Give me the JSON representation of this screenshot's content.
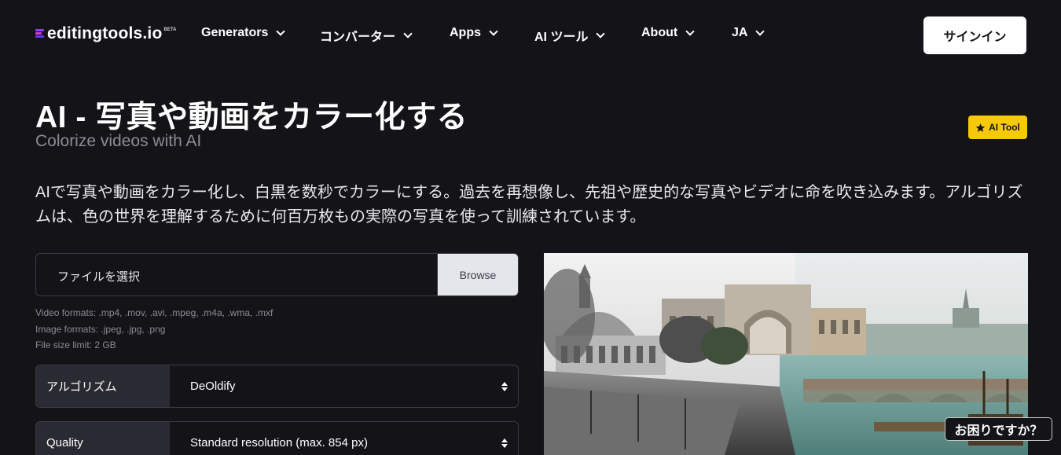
{
  "nav": {
    "logo_text": "editingtools.io",
    "logo_beta": "BETA",
    "items": [
      {
        "label": "Generators"
      },
      {
        "label": "コンバーター"
      },
      {
        "label": "Apps"
      },
      {
        "label": "AI ツール"
      },
      {
        "label": "About"
      },
      {
        "label": "JA"
      }
    ],
    "signin_label": "サインイン"
  },
  "header": {
    "title": "AI - 写真や動画をカラー化する",
    "subtitle": "Colorize videos with AI",
    "badge_label": "AI Tool",
    "description": "AIで写真や動画をカラー化し、白黒を数秒でカラーにする。過去を再想像し、先祖や歴史的な写真やビデオに命を吹き込みます。アルゴリズムは、色の世界を理解するために何百万枚もの実際の写真を使って訓練されています。"
  },
  "form": {
    "file_placeholder": "ファイルを選択",
    "browse_label": "Browse",
    "formats": [
      "Video formats: .mp4, .mov, .avi, .mpeg, .m4a, .wma, .mxf",
      "Image formats: .jpeg, .jpg, .png",
      "File size limit: 2 GB"
    ],
    "algorithm": {
      "label": "アルゴリズム",
      "value": "DeOldify"
    },
    "quality": {
      "label": "Quality",
      "value": "Standard resolution (max. 854 px)"
    }
  },
  "help_label": "お困りですか？",
  "colors": {
    "background": "#141418",
    "accent_badge": "#f6c90b",
    "panel": "#2a2a32",
    "border": "#3a3a44"
  }
}
